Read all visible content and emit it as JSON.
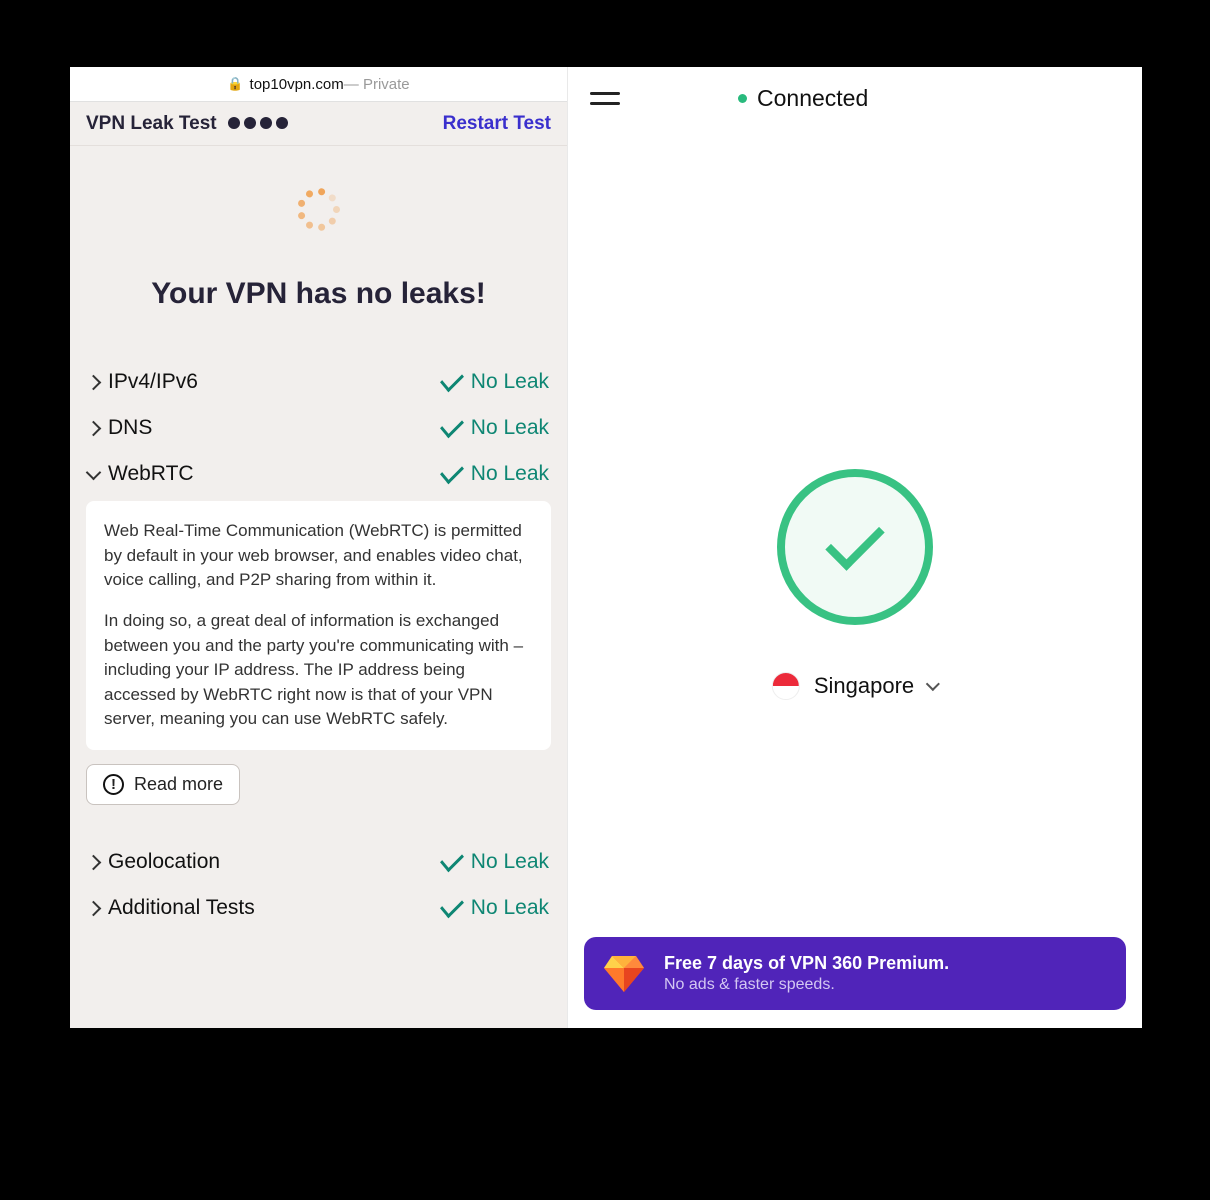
{
  "browser": {
    "domain": "top10vpn.com",
    "private_label": " — Private"
  },
  "leak_test": {
    "title": "VPN Leak Test",
    "restart_label": "Restart Test",
    "hero": "Your VPN has no leaks!",
    "rows": [
      {
        "label": "IPv4/IPv6",
        "status": "No Leak",
        "open": false
      },
      {
        "label": "DNS",
        "status": "No Leak",
        "open": false
      },
      {
        "label": "WebRTC",
        "status": "No Leak",
        "open": true
      }
    ],
    "webrtc_detail": {
      "p1": "Web Real-Time Communication (WebRTC) is permitted by default in your web browser, and enables video chat, voice calling, and P2P sharing from within it.",
      "p2": "In doing so, a great deal of information is exchanged between you and the party you're communicating with – including your IP address. The IP address being accessed by WebRTC right now is that of your VPN server, meaning you can use WebRTC safely."
    },
    "read_more": "Read more",
    "tail_rows": [
      {
        "label": "Geolocation",
        "status": "No Leak"
      },
      {
        "label": "Additional Tests",
        "status": "No Leak"
      }
    ]
  },
  "vpn_app": {
    "status": "Connected",
    "location": "Singapore",
    "promo_title": "Free 7 days of VPN 360 Premium.",
    "promo_sub": "No ads & faster speeds."
  }
}
